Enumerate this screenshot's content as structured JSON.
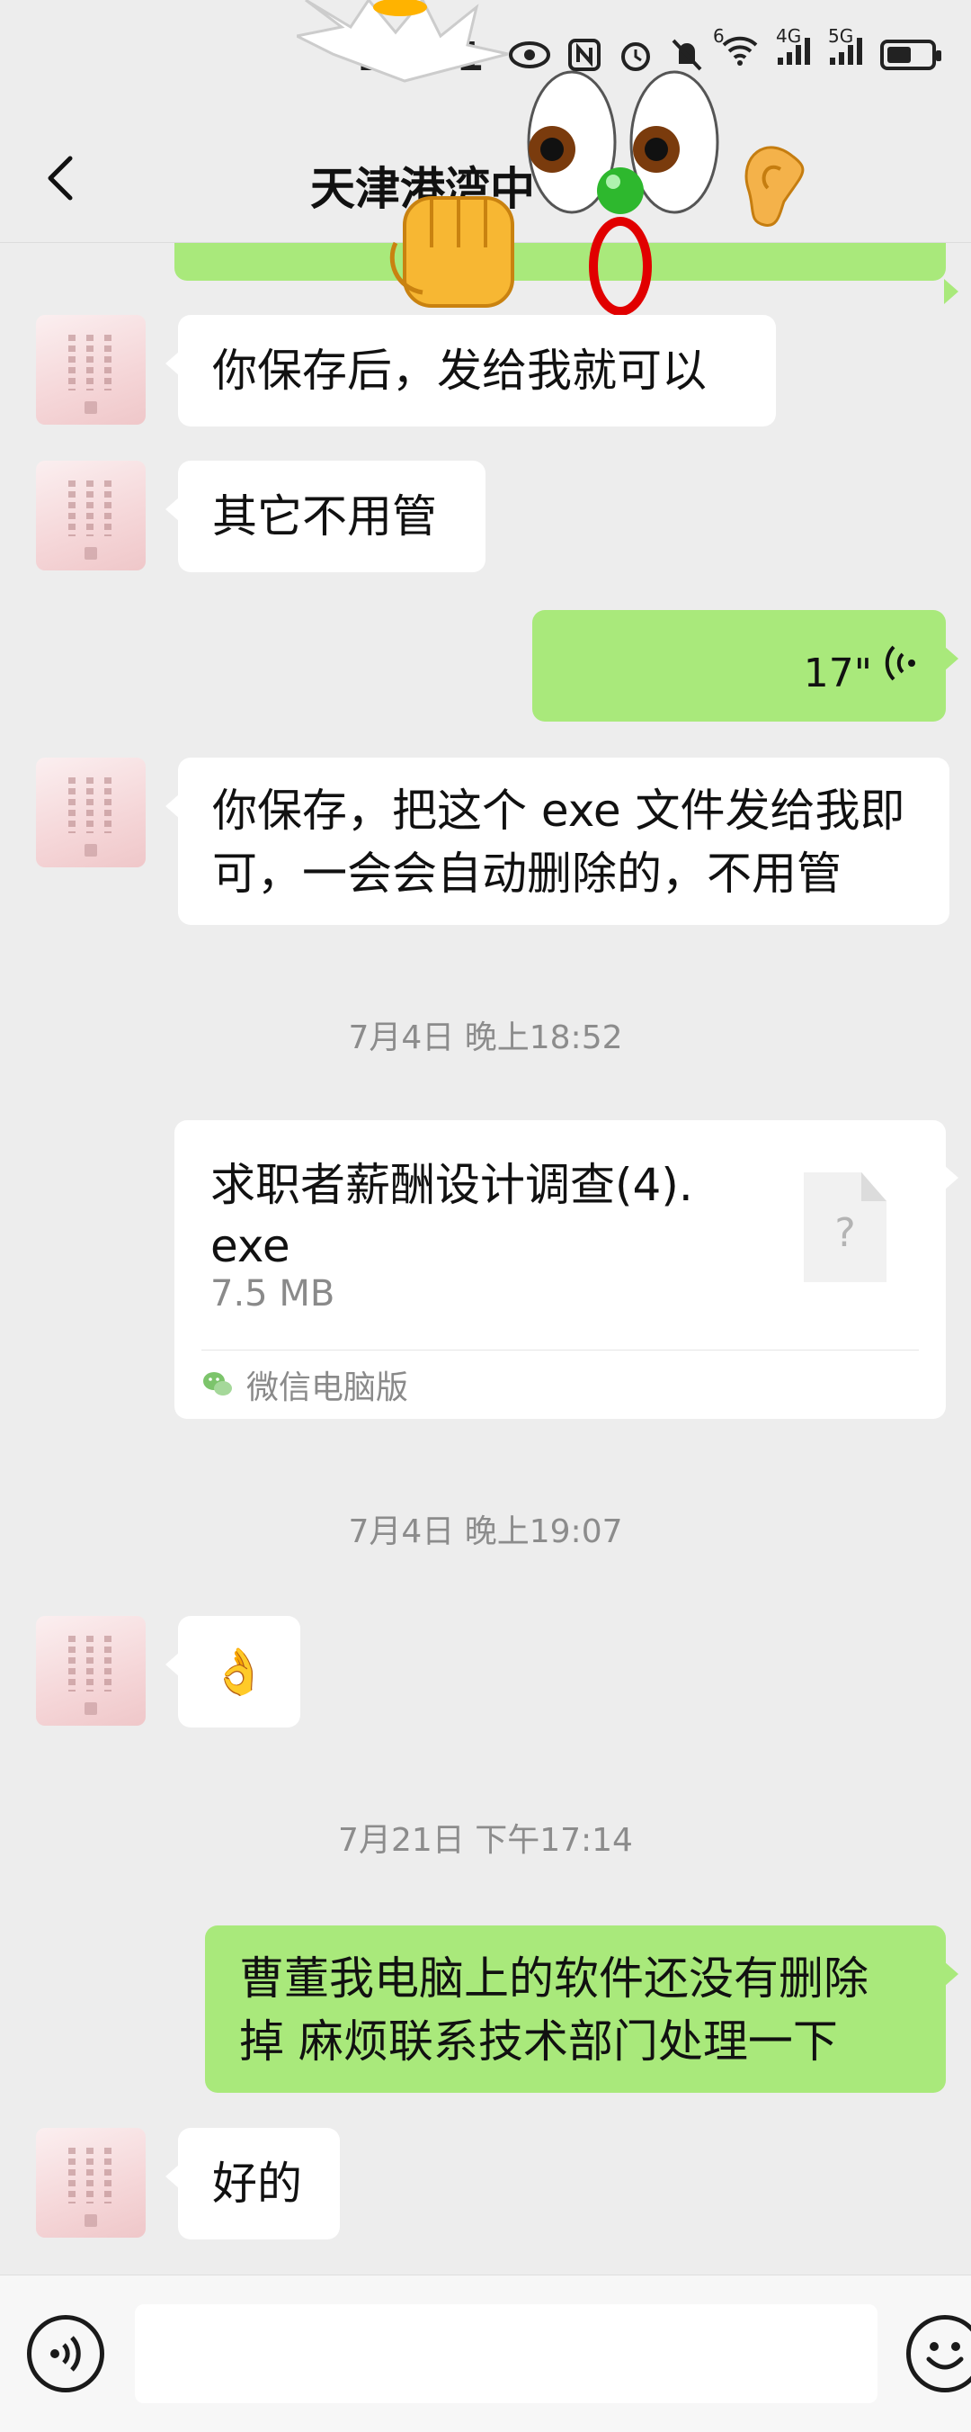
{
  "status_bar": {
    "time": "21:01",
    "icons": [
      "eye-icon",
      "nfc-icon",
      "alarm-icon",
      "mute-icon",
      "wifi-icon",
      "signal-4g-icon",
      "signal-5g-icon",
      "battery-icon"
    ],
    "network_labels": [
      "6",
      "4G",
      "5G"
    ]
  },
  "header": {
    "title": "天津港湾中"
  },
  "messages": [
    {
      "side": "in",
      "text": "你保存后，发给我就可以"
    },
    {
      "side": "in",
      "text": "其它不用管"
    },
    {
      "side": "out",
      "type": "voice",
      "duration": "17\""
    },
    {
      "side": "in",
      "text_lines": [
        "你保存，把这个 exe 文件发给我即",
        "可，一会会自动删除的，不用管"
      ]
    },
    {
      "type": "timestamp",
      "text": "7月4日 晚上18:52"
    },
    {
      "side": "in",
      "type": "file",
      "name_lines": [
        "求职者薪酬设计调查(4).",
        "exe"
      ],
      "size": "7.5 MB",
      "icon_glyph": "?",
      "source": "微信电脑版"
    },
    {
      "type": "timestamp",
      "text": "7月4日 晚上19:07"
    },
    {
      "side": "in",
      "type": "emoji",
      "emoji": "👌"
    },
    {
      "type": "timestamp",
      "text": "7月21日 下午17:14"
    },
    {
      "side": "out",
      "text_lines": [
        "曹董我电脑上的软件还没有删除",
        "掉 麻烦联系技术部门处理一下"
      ]
    },
    {
      "side": "in",
      "text": "好的"
    }
  ],
  "colors": {
    "background": "#ededed",
    "outgoing_bubble": "#a9e97b",
    "incoming_bubble": "#ffffff",
    "timestamp_text": "#8c8c8c"
  }
}
